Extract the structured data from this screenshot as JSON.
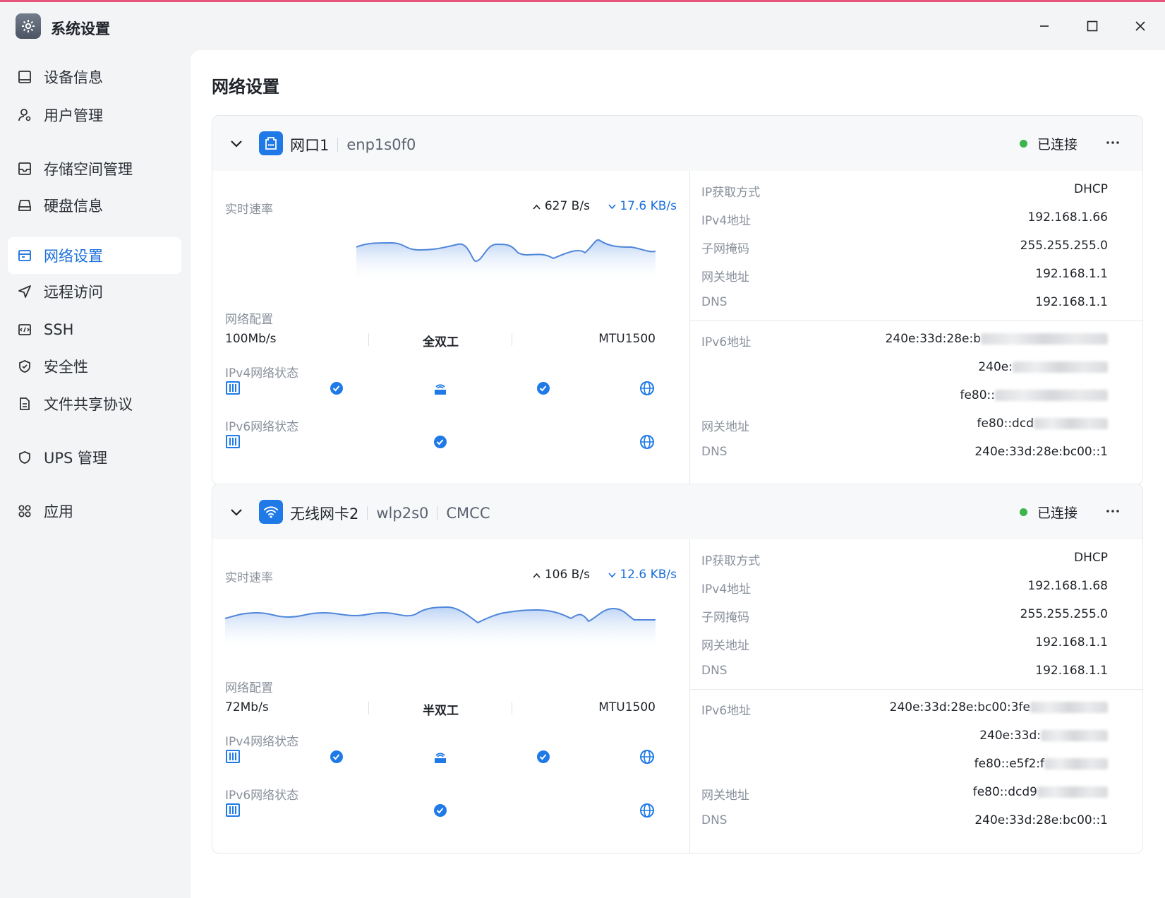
{
  "app": {
    "title": "系统设置"
  },
  "sidebar": {
    "items": [
      {
        "label": "设备信息",
        "icon": "device-icon"
      },
      {
        "label": "用户管理",
        "icon": "user-icon"
      },
      {
        "label": "存储空间管理",
        "icon": "storage-icon"
      },
      {
        "label": "硬盘信息",
        "icon": "disk-icon"
      },
      {
        "label": "网络设置",
        "icon": "network-icon",
        "active": true
      },
      {
        "label": "远程访问",
        "icon": "send-icon"
      },
      {
        "label": "SSH",
        "icon": "terminal-icon"
      },
      {
        "label": "安全性",
        "icon": "shield-icon"
      },
      {
        "label": "文件共享协议",
        "icon": "document-icon"
      },
      {
        "label": "UPS 管理",
        "icon": "ups-shield-icon"
      },
      {
        "label": "应用",
        "icon": "apps-icon"
      }
    ]
  },
  "main": {
    "title": "网络设置",
    "cards": [
      {
        "name": "网口1",
        "sub1": "enp1s0f0",
        "sub2": "",
        "status": "已连接",
        "speed_label": "实时速率",
        "speed_up": "627 B/s",
        "speed_down": "17.6 KB/s",
        "config_label": "网络配置",
        "config": {
          "rate": "100Mb/s",
          "duplex": "全双工",
          "mtu": "MTU1500"
        },
        "ipv4_label": "IPv4网络状态",
        "ipv6_label": "IPv6网络状态",
        "info": {
          "ip_method_k": "IP获取方式",
          "ip_method_v": "DHCP",
          "ipv4_k": "IPv4地址",
          "ipv4_v": "192.168.1.66",
          "mask_k": "子网掩码",
          "mask_v": "255.255.255.0",
          "gw_k": "网关地址",
          "gw_v": "192.168.1.1",
          "dns_k": "DNS",
          "dns_v": "192.168.1.1",
          "ipv6_k": "IPv6地址",
          "ipv6_1": "240e:33d:28e:b",
          "ipv6_2": "240e:",
          "ipv6_3": "fe80::",
          "gw6_k": "网关地址",
          "gw6_v": "fe80::dcd",
          "dns6_k": "DNS",
          "dns6_v": "240e:33d:28e:bc00::1"
        }
      },
      {
        "name": "无线网卡2",
        "sub1": "wlp2s0",
        "sub2": "CMCC",
        "status": "已连接",
        "speed_label": "实时速率",
        "speed_up": "106 B/s",
        "speed_down": "12.6 KB/s",
        "config_label": "网络配置",
        "config": {
          "rate": "72Mb/s",
          "duplex": "半双工",
          "mtu": "MTU1500"
        },
        "ipv4_label": "IPv4网络状态",
        "ipv6_label": "IPv6网络状态",
        "info": {
          "ip_method_k": "IP获取方式",
          "ip_method_v": "DHCP",
          "ipv4_k": "IPv4地址",
          "ipv4_v": "192.168.1.68",
          "mask_k": "子网掩码",
          "mask_v": "255.255.255.0",
          "gw_k": "网关地址",
          "gw_v": "192.168.1.1",
          "dns_k": "DNS",
          "dns_v": "192.168.1.1",
          "ipv6_k": "IPv6地址",
          "ipv6_1": "240e:33d:28e:bc00:3fe",
          "ipv6_2": "240e:33d:",
          "ipv6_3": "fe80::e5f2:f",
          "gw6_k": "网关地址",
          "gw6_v": "fe80::dcd9",
          "dns6_k": "DNS",
          "dns6_v": "240e:33d:28e:bc00::1"
        }
      }
    ]
  },
  "colors": {
    "accent": "#1a6fdb",
    "connected": "#3bb54a",
    "chart_fill": "#c9dcf7"
  }
}
